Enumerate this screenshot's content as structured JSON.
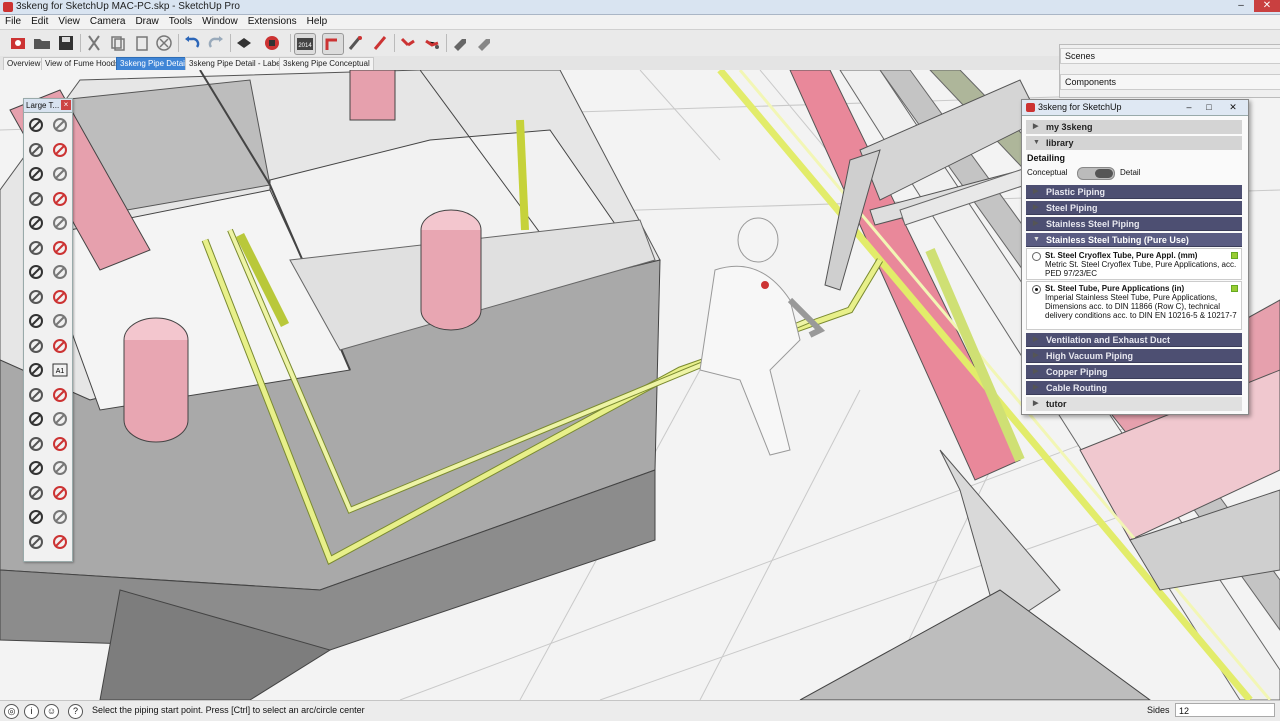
{
  "window": {
    "title": "3skeng for SketchUp MAC-PC.skp - SketchUp Pro"
  },
  "menu": [
    "File",
    "Edit",
    "View",
    "Camera",
    "Draw",
    "Tools",
    "Window",
    "Extensions",
    "Help"
  ],
  "toolbar": {
    "icons": [
      "open-model-icon",
      "open-folder-icon",
      "save-icon",
      "cut-icon",
      "copy-icon",
      "paste-icon",
      "erase-icon",
      "undo-icon",
      "redo-icon",
      "print-icon",
      "model-info-icon",
      "version-2014-icon",
      "3skeng-pipe-icon",
      "3skeng-tube-icon",
      "3skeng-duct-icon",
      "3skeng-fitting-icon",
      "3skeng-mount-icon",
      "3skeng-list-icon",
      "3skeng-export-icon"
    ],
    "version_label": "2014"
  },
  "tabs": [
    {
      "label": "Overview",
      "active": false
    },
    {
      "label": "View of Fume Hoods",
      "active": false
    },
    {
      "label": "3skeng Pipe Detail",
      "active": true
    },
    {
      "label": "3skeng Pipe Detail - Label",
      "active": false
    },
    {
      "label": "3skeng Pipe Conceptual",
      "active": false
    }
  ],
  "palette": {
    "title": "Large T...",
    "tools": [
      "select-icon",
      "make-component-icon",
      "paint-bucket-icon",
      "eraser-icon",
      "pencil-icon",
      "freehand-icon",
      "rectangle-icon",
      "rotated-rectangle-icon",
      "circle-icon",
      "polygon-icon",
      "arc-icon",
      "two-point-arc-icon",
      "three-point-arc-icon",
      "pie-icon",
      "move-icon",
      "push-pull-icon",
      "rotate-icon",
      "follow-me-icon",
      "scale-icon",
      "offset-icon",
      "tape-measure-icon",
      "dimension-icon",
      "protractor-icon",
      "text-icon",
      "axes-icon",
      "3d-text-icon",
      "orbit-icon",
      "pan-icon",
      "zoom-icon",
      "zoom-window-icon",
      "zoom-extents-icon",
      "previous-view-icon",
      "position-camera-icon",
      "look-around-icon",
      "walk-icon",
      "section-plane-icon"
    ],
    "text_tool_label": "A1"
  },
  "tray": {
    "scenes": "Scenes",
    "components": "Components"
  },
  "panel": {
    "title": "3skeng for SketchUp",
    "my": "my 3skeng",
    "library": "library",
    "detailing_label": "Detailing",
    "toggle_left": "Conceptual",
    "toggle_right": "Detail",
    "categories_top": [
      "Plastic Piping",
      "Steel Piping",
      "Stainless Steel Piping"
    ],
    "open_category": "Stainless Steel Tubing (Pure Use)",
    "items": [
      {
        "title": "St. Steel Cryoflex Tube, Pure Appl. (mm)",
        "desc": "Metric St. Steel Cryoflex Tube, Pure Applications, acc. PED 97/23/EC",
        "selected": false
      },
      {
        "title": "St. Steel Tube, Pure Applications (in)",
        "desc": "Imperial Stainless Steel Tube, Pure Applications, Dimensions acc. to DIN 11866 (Row C), technical delivery conditions acc. to DIN EN 10216-5 & 10217-7",
        "selected": true
      }
    ],
    "categories_bottom": [
      "Ventilation and Exhaust Duct",
      "High Vacuum Piping",
      "Copper Piping",
      "Cable Routing"
    ],
    "tutor": "tutor"
  },
  "status": {
    "icons": [
      "geo-location-icon",
      "info-icon",
      "user-icon",
      "help-icon"
    ],
    "text": "Select the piping start point. Press [Ctrl] to select an arc/circle center",
    "sides_label": "Sides",
    "sides_value": "12"
  },
  "colors": {
    "accent": "#3f85d6",
    "category": "#4d4f72",
    "pipe_pink": "#e9889a",
    "pipe_yellow": "#e8f08a"
  }
}
